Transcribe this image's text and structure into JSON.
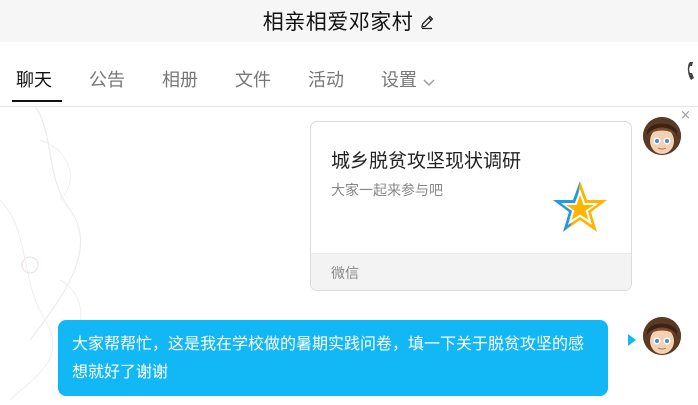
{
  "window": {
    "title": "相亲相爱邓家村"
  },
  "tabs": [
    {
      "label": "聊天",
      "active": true
    },
    {
      "label": "公告",
      "active": false
    },
    {
      "label": "相册",
      "active": false
    },
    {
      "label": "文件",
      "active": false
    },
    {
      "label": "活动",
      "active": false
    },
    {
      "label": "设置",
      "active": false
    }
  ],
  "icons": {
    "title_edit": "pencil-icon",
    "settings_dropdown": "chevron-down-icon",
    "call": "phone-icon",
    "card_logo": "star-icon",
    "close": "close-icon"
  },
  "messages": [
    {
      "type": "card",
      "title": "城乡脱贫攻坚现状调研",
      "description": "大家一起来参与吧",
      "source": "微信"
    },
    {
      "type": "text",
      "text": "大家帮帮忙，这是我在学校做的暑期实践问卷，填一下关于脱贫攻坚的感想就好了谢谢"
    }
  ],
  "close_symbol": "×",
  "colors": {
    "accent": "#12b7f5",
    "star_yellow": "#ffb400",
    "star_blue": "#1e9be8"
  }
}
